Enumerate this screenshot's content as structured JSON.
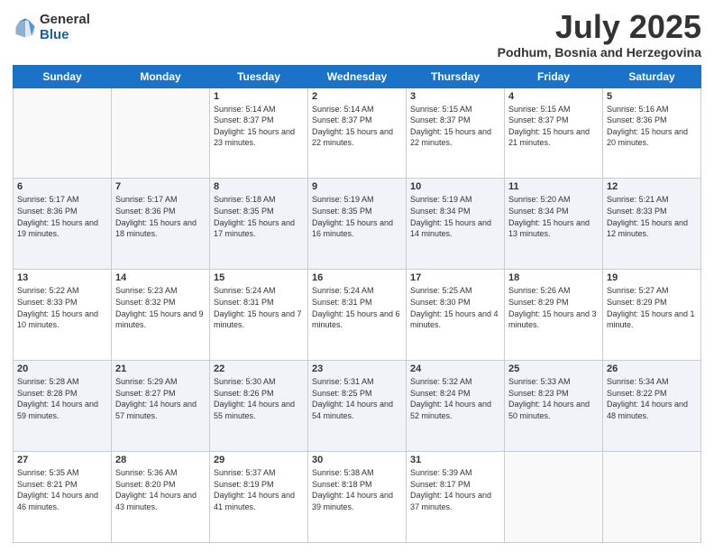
{
  "logo": {
    "general": "General",
    "blue": "Blue"
  },
  "header": {
    "month": "July 2025",
    "location": "Podhum, Bosnia and Herzegovina"
  },
  "days_of_week": [
    "Sunday",
    "Monday",
    "Tuesday",
    "Wednesday",
    "Thursday",
    "Friday",
    "Saturday"
  ],
  "weeks": [
    [
      {
        "day": "",
        "sunrise": "",
        "sunset": "",
        "daylight": ""
      },
      {
        "day": "",
        "sunrise": "",
        "sunset": "",
        "daylight": ""
      },
      {
        "day": "1",
        "sunrise": "Sunrise: 5:14 AM",
        "sunset": "Sunset: 8:37 PM",
        "daylight": "Daylight: 15 hours and 23 minutes."
      },
      {
        "day": "2",
        "sunrise": "Sunrise: 5:14 AM",
        "sunset": "Sunset: 8:37 PM",
        "daylight": "Daylight: 15 hours and 22 minutes."
      },
      {
        "day": "3",
        "sunrise": "Sunrise: 5:15 AM",
        "sunset": "Sunset: 8:37 PM",
        "daylight": "Daylight: 15 hours and 22 minutes."
      },
      {
        "day": "4",
        "sunrise": "Sunrise: 5:15 AM",
        "sunset": "Sunset: 8:37 PM",
        "daylight": "Daylight: 15 hours and 21 minutes."
      },
      {
        "day": "5",
        "sunrise": "Sunrise: 5:16 AM",
        "sunset": "Sunset: 8:36 PM",
        "daylight": "Daylight: 15 hours and 20 minutes."
      }
    ],
    [
      {
        "day": "6",
        "sunrise": "Sunrise: 5:17 AM",
        "sunset": "Sunset: 8:36 PM",
        "daylight": "Daylight: 15 hours and 19 minutes."
      },
      {
        "day": "7",
        "sunrise": "Sunrise: 5:17 AM",
        "sunset": "Sunset: 8:36 PM",
        "daylight": "Daylight: 15 hours and 18 minutes."
      },
      {
        "day": "8",
        "sunrise": "Sunrise: 5:18 AM",
        "sunset": "Sunset: 8:35 PM",
        "daylight": "Daylight: 15 hours and 17 minutes."
      },
      {
        "day": "9",
        "sunrise": "Sunrise: 5:19 AM",
        "sunset": "Sunset: 8:35 PM",
        "daylight": "Daylight: 15 hours and 16 minutes."
      },
      {
        "day": "10",
        "sunrise": "Sunrise: 5:19 AM",
        "sunset": "Sunset: 8:34 PM",
        "daylight": "Daylight: 15 hours and 14 minutes."
      },
      {
        "day": "11",
        "sunrise": "Sunrise: 5:20 AM",
        "sunset": "Sunset: 8:34 PM",
        "daylight": "Daylight: 15 hours and 13 minutes."
      },
      {
        "day": "12",
        "sunrise": "Sunrise: 5:21 AM",
        "sunset": "Sunset: 8:33 PM",
        "daylight": "Daylight: 15 hours and 12 minutes."
      }
    ],
    [
      {
        "day": "13",
        "sunrise": "Sunrise: 5:22 AM",
        "sunset": "Sunset: 8:33 PM",
        "daylight": "Daylight: 15 hours and 10 minutes."
      },
      {
        "day": "14",
        "sunrise": "Sunrise: 5:23 AM",
        "sunset": "Sunset: 8:32 PM",
        "daylight": "Daylight: 15 hours and 9 minutes."
      },
      {
        "day": "15",
        "sunrise": "Sunrise: 5:24 AM",
        "sunset": "Sunset: 8:31 PM",
        "daylight": "Daylight: 15 hours and 7 minutes."
      },
      {
        "day": "16",
        "sunrise": "Sunrise: 5:24 AM",
        "sunset": "Sunset: 8:31 PM",
        "daylight": "Daylight: 15 hours and 6 minutes."
      },
      {
        "day": "17",
        "sunrise": "Sunrise: 5:25 AM",
        "sunset": "Sunset: 8:30 PM",
        "daylight": "Daylight: 15 hours and 4 minutes."
      },
      {
        "day": "18",
        "sunrise": "Sunrise: 5:26 AM",
        "sunset": "Sunset: 8:29 PM",
        "daylight": "Daylight: 15 hours and 3 minutes."
      },
      {
        "day": "19",
        "sunrise": "Sunrise: 5:27 AM",
        "sunset": "Sunset: 8:29 PM",
        "daylight": "Daylight: 15 hours and 1 minute."
      }
    ],
    [
      {
        "day": "20",
        "sunrise": "Sunrise: 5:28 AM",
        "sunset": "Sunset: 8:28 PM",
        "daylight": "Daylight: 14 hours and 59 minutes."
      },
      {
        "day": "21",
        "sunrise": "Sunrise: 5:29 AM",
        "sunset": "Sunset: 8:27 PM",
        "daylight": "Daylight: 14 hours and 57 minutes."
      },
      {
        "day": "22",
        "sunrise": "Sunrise: 5:30 AM",
        "sunset": "Sunset: 8:26 PM",
        "daylight": "Daylight: 14 hours and 55 minutes."
      },
      {
        "day": "23",
        "sunrise": "Sunrise: 5:31 AM",
        "sunset": "Sunset: 8:25 PM",
        "daylight": "Daylight: 14 hours and 54 minutes."
      },
      {
        "day": "24",
        "sunrise": "Sunrise: 5:32 AM",
        "sunset": "Sunset: 8:24 PM",
        "daylight": "Daylight: 14 hours and 52 minutes."
      },
      {
        "day": "25",
        "sunrise": "Sunrise: 5:33 AM",
        "sunset": "Sunset: 8:23 PM",
        "daylight": "Daylight: 14 hours and 50 minutes."
      },
      {
        "day": "26",
        "sunrise": "Sunrise: 5:34 AM",
        "sunset": "Sunset: 8:22 PM",
        "daylight": "Daylight: 14 hours and 48 minutes."
      }
    ],
    [
      {
        "day": "27",
        "sunrise": "Sunrise: 5:35 AM",
        "sunset": "Sunset: 8:21 PM",
        "daylight": "Daylight: 14 hours and 46 minutes."
      },
      {
        "day": "28",
        "sunrise": "Sunrise: 5:36 AM",
        "sunset": "Sunset: 8:20 PM",
        "daylight": "Daylight: 14 hours and 43 minutes."
      },
      {
        "day": "29",
        "sunrise": "Sunrise: 5:37 AM",
        "sunset": "Sunset: 8:19 PM",
        "daylight": "Daylight: 14 hours and 41 minutes."
      },
      {
        "day": "30",
        "sunrise": "Sunrise: 5:38 AM",
        "sunset": "Sunset: 8:18 PM",
        "daylight": "Daylight: 14 hours and 39 minutes."
      },
      {
        "day": "31",
        "sunrise": "Sunrise: 5:39 AM",
        "sunset": "Sunset: 8:17 PM",
        "daylight": "Daylight: 14 hours and 37 minutes."
      },
      {
        "day": "",
        "sunrise": "",
        "sunset": "",
        "daylight": ""
      },
      {
        "day": "",
        "sunrise": "",
        "sunset": "",
        "daylight": ""
      }
    ]
  ]
}
